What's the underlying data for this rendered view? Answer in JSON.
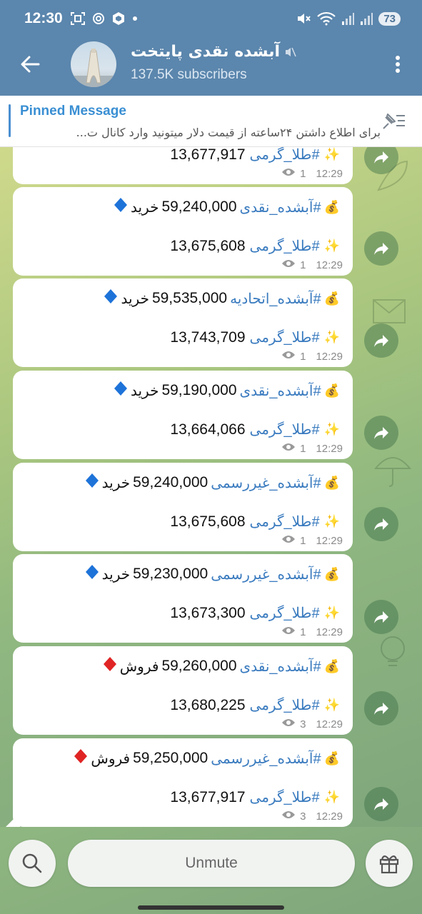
{
  "status_bar": {
    "time": "12:30",
    "battery": "73",
    "left_icons": [
      "screenshot-icon",
      "openai-icon",
      "hexagon-icon",
      "dot-icon"
    ],
    "right_icons": [
      "mute-icon",
      "wifi-icon",
      "signal-icon",
      "signal-icon"
    ]
  },
  "header": {
    "title": "آبشده نقدی پایتخت",
    "subscribers": "137.5K subscribers",
    "colors": {
      "bar": "#5b86ad"
    }
  },
  "pinned": {
    "label": "Pinned Message",
    "text": "برای اطلاع داشتن ۲۴ساعته از قیمت دلار میتونید وارد کانال ت..."
  },
  "messages": [
    {
      "line1": null,
      "tag2": "#طلا_گرمی",
      "value2": "13,677,917",
      "views": "1",
      "time": "12:29"
    },
    {
      "tag1": "#آبشده_نقدی",
      "value1": "59,240,000",
      "action": "خرید",
      "diamond": "blue",
      "tag2": "#طلا_گرمی",
      "value2": "13,675,608",
      "views": "1",
      "time": "12:29"
    },
    {
      "tag1": "#آبشده_اتحادیه",
      "value1": "59,535,000",
      "action": "خرید",
      "diamond": "blue",
      "tag2": "#طلا_گرمی",
      "value2": "13,743,709",
      "views": "1",
      "time": "12:29"
    },
    {
      "tag1": "#آبشده_نقدی",
      "value1": "59,190,000",
      "action": "خرید",
      "diamond": "blue",
      "tag2": "#طلا_گرمی",
      "value2": "13,664,066",
      "views": "1",
      "time": "12:29"
    },
    {
      "tag1": "#آبشده_غیررسمی",
      "value1": "59,240,000",
      "action": "خرید",
      "diamond": "blue",
      "tag2": "#طلا_گرمی",
      "value2": "13,675,608",
      "views": "1",
      "time": "12:29"
    },
    {
      "tag1": "#آبشده_غیررسمی",
      "value1": "59,230,000",
      "action": "خرید",
      "diamond": "blue",
      "tag2": "#طلا_گرمی",
      "value2": "13,673,300",
      "views": "1",
      "time": "12:29"
    },
    {
      "tag1": "#آبشده_نقدی",
      "value1": "59,260,000",
      "action": "فروش",
      "diamond": "red",
      "tag2": "#طلا_گرمی",
      "value2": "13,680,225",
      "views": "3",
      "time": "12:29"
    },
    {
      "tag1": "#آبشده_غیررسمی",
      "value1": "59,250,000",
      "action": "فروش",
      "diamond": "red",
      "tag2": "#طلا_گرمی",
      "value2": "13,677,917",
      "views": "3",
      "time": "12:29"
    }
  ],
  "bottom_bar": {
    "unmute_label": "Unmute",
    "left_icon": "search-icon",
    "right_icon": "gift-icon"
  },
  "colors": {
    "tag": "#3a7bbf",
    "diamond_blue": "#1e73d9",
    "diamond_red": "#e02424"
  }
}
